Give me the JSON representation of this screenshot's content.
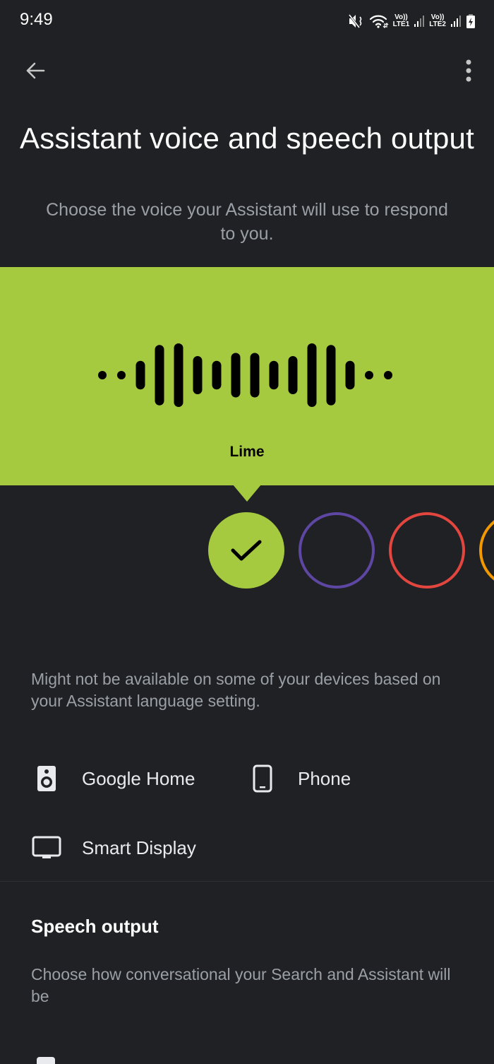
{
  "status_bar": {
    "time": "9:49",
    "icons": [
      "mute-icon",
      "wifi-icon",
      "signal-sim1-icon",
      "signal-sim2-icon",
      "battery-charging-icon"
    ],
    "sim1_label_top": "Vo))",
    "sim1_label_bottom": "LTE1",
    "sim2_label_top": "Vo))",
    "sim2_label_bottom": "LTE2"
  },
  "app_bar": {
    "back_icon": "arrow-back-icon",
    "menu_icon": "more-vert-icon"
  },
  "page": {
    "title": "Assistant voice and speech output",
    "subtitle": "Choose the voice your Assistant will use to respond to you."
  },
  "voice_picker": {
    "selected_voice": "Lime",
    "banner_color": "#a6ca3f",
    "waveform_bar_levels": [
      0.1,
      0.1,
      0.45,
      0.95,
      1.0,
      0.6,
      0.45,
      0.7,
      0.7,
      0.45,
      0.6,
      1.0,
      0.95,
      0.45,
      0.1,
      0.1
    ],
    "options": [
      {
        "name": "Lime",
        "color": "#a6ca3f",
        "selected": true
      },
      {
        "name": "Purple",
        "color": "#5e46a3",
        "selected": false
      },
      {
        "name": "Red",
        "color": "#e2463f",
        "selected": false
      },
      {
        "name": "Orange",
        "color": "#f29900",
        "selected": false
      }
    ]
  },
  "availability_note": "Might not be available on some of your devices based on your Assistant language setting.",
  "devices": [
    {
      "label": "Google Home",
      "icon": "speaker-icon"
    },
    {
      "label": "Phone",
      "icon": "phone-icon"
    },
    {
      "label": "Smart Display",
      "icon": "display-icon"
    }
  ],
  "speech_output": {
    "title": "Speech output",
    "description": "Choose how conversational your Search and Assistant will be"
  }
}
